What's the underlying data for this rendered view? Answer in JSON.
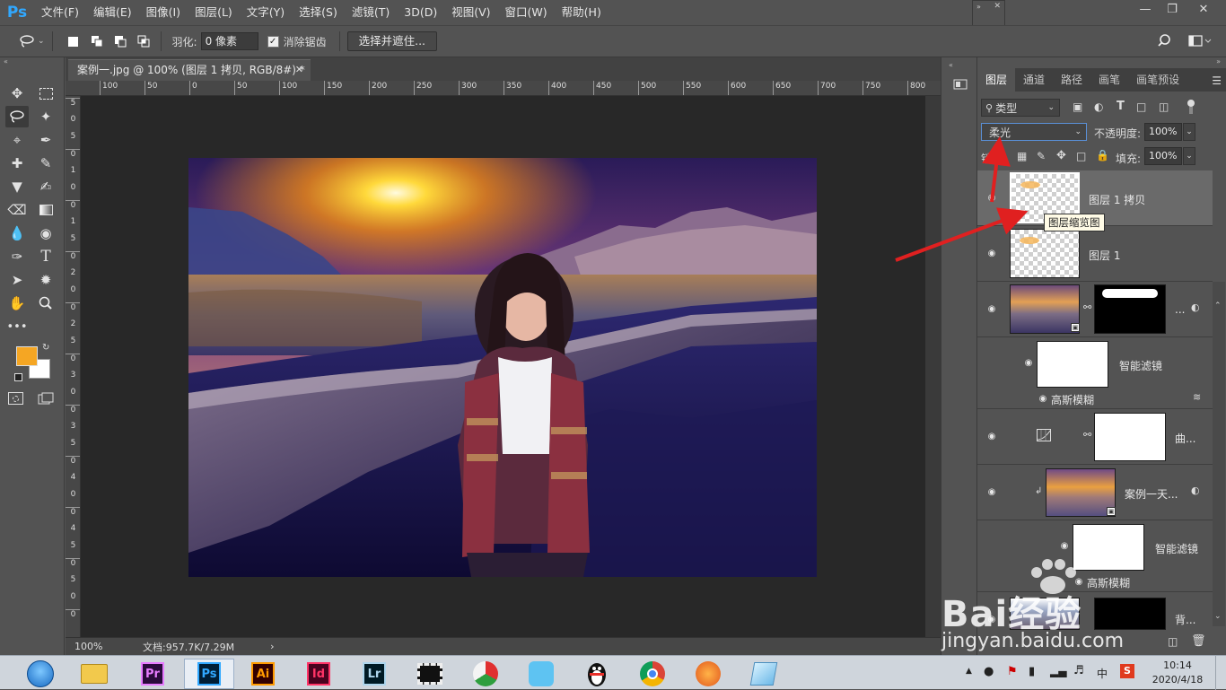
{
  "app": {
    "logo": "Ps"
  },
  "menu": [
    "文件(F)",
    "编辑(E)",
    "图像(I)",
    "图层(L)",
    "文字(Y)",
    "选择(S)",
    "滤镜(T)",
    "3D(D)",
    "视图(V)",
    "窗口(W)",
    "帮助(H)"
  ],
  "options": {
    "feather_label": "羽化:",
    "feather_value": "0 像素",
    "antialias_label": "消除锯齿",
    "select_mask_button": "选择并遮住..."
  },
  "document": {
    "tab_title": "案例一.jpg @ 100% (图层 1 拷贝, RGB/8#) *",
    "zoom": "100%",
    "doc_size": "文档:957.7K/7.29M"
  },
  "ruler": {
    "top_ticks": [
      "100",
      "50",
      "0",
      "50",
      "100",
      "150",
      "200",
      "250",
      "300",
      "350",
      "400",
      "450",
      "500",
      "550",
      "600",
      "650",
      "700",
      "750",
      "800"
    ],
    "left_ticks": [
      "5",
      "0",
      "5",
      "0",
      "1",
      "0",
      "0",
      "1",
      "5",
      "0",
      "2",
      "0",
      "0",
      "2",
      "5",
      "0",
      "3",
      "0",
      "0",
      "3",
      "5",
      "0",
      "4",
      "0",
      "0",
      "4",
      "5",
      "0",
      "5",
      "0",
      "0"
    ]
  },
  "layers_panel": {
    "tabs": [
      "图层",
      "通道",
      "路径",
      "画笔",
      "画笔预设"
    ],
    "filter_kind": "类型",
    "blend_mode": "柔光",
    "opacity_label": "不透明度:",
    "opacity_value": "100%",
    "lock_label": "锁定:",
    "fill_label": "填充:",
    "fill_value": "100%",
    "tooltip": "图层缩览图",
    "layers": [
      {
        "name": "图层 1 拷贝"
      },
      {
        "name": "图层 1"
      },
      {
        "name": "..."
      },
      {
        "name": "智能滤镜"
      },
      {
        "name": "高斯模糊"
      },
      {
        "name": "曲..."
      },
      {
        "name": "案例一天..."
      },
      {
        "name": "智能滤镜"
      },
      {
        "name": "高斯模糊"
      },
      {
        "name": "背..."
      }
    ]
  },
  "taskbar": {
    "apps": [
      "Pr",
      "Ps",
      "Ai",
      "Id",
      "Lr"
    ],
    "time": "10:14",
    "date": "2020/4/18",
    "ime": "中"
  },
  "watermark": {
    "brand": "Bai经验",
    "url": "jingyan.baidu.com"
  },
  "colors": {
    "foreground": "#f5a623",
    "background": "#ffffff",
    "ps_blue": "#31a8ff",
    "arrow_red": "#e02020"
  }
}
